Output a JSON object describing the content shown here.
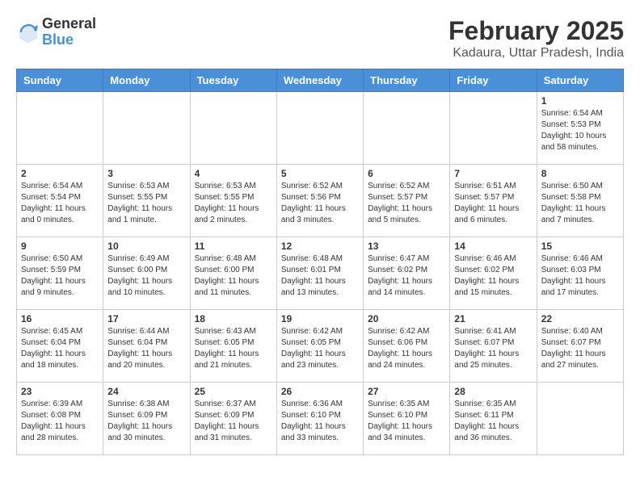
{
  "logo": {
    "general": "General",
    "blue": "Blue"
  },
  "header": {
    "month": "February 2025",
    "location": "Kadaura, Uttar Pradesh, India"
  },
  "weekdays": [
    "Sunday",
    "Monday",
    "Tuesday",
    "Wednesday",
    "Thursday",
    "Friday",
    "Saturday"
  ],
  "weeks": [
    [
      {
        "day": "",
        "info": ""
      },
      {
        "day": "",
        "info": ""
      },
      {
        "day": "",
        "info": ""
      },
      {
        "day": "",
        "info": ""
      },
      {
        "day": "",
        "info": ""
      },
      {
        "day": "",
        "info": ""
      },
      {
        "day": "1",
        "info": "Sunrise: 6:54 AM\nSunset: 5:53 PM\nDaylight: 10 hours\nand 58 minutes."
      }
    ],
    [
      {
        "day": "2",
        "info": "Sunrise: 6:54 AM\nSunset: 5:54 PM\nDaylight: 11 hours\nand 0 minutes."
      },
      {
        "day": "3",
        "info": "Sunrise: 6:53 AM\nSunset: 5:55 PM\nDaylight: 11 hours\nand 1 minute."
      },
      {
        "day": "4",
        "info": "Sunrise: 6:53 AM\nSunset: 5:55 PM\nDaylight: 11 hours\nand 2 minutes."
      },
      {
        "day": "5",
        "info": "Sunrise: 6:52 AM\nSunset: 5:56 PM\nDaylight: 11 hours\nand 3 minutes."
      },
      {
        "day": "6",
        "info": "Sunrise: 6:52 AM\nSunset: 5:57 PM\nDaylight: 11 hours\nand 5 minutes."
      },
      {
        "day": "7",
        "info": "Sunrise: 6:51 AM\nSunset: 5:57 PM\nDaylight: 11 hours\nand 6 minutes."
      },
      {
        "day": "8",
        "info": "Sunrise: 6:50 AM\nSunset: 5:58 PM\nDaylight: 11 hours\nand 7 minutes."
      }
    ],
    [
      {
        "day": "9",
        "info": "Sunrise: 6:50 AM\nSunset: 5:59 PM\nDaylight: 11 hours\nand 9 minutes."
      },
      {
        "day": "10",
        "info": "Sunrise: 6:49 AM\nSunset: 6:00 PM\nDaylight: 11 hours\nand 10 minutes."
      },
      {
        "day": "11",
        "info": "Sunrise: 6:48 AM\nSunset: 6:00 PM\nDaylight: 11 hours\nand 11 minutes."
      },
      {
        "day": "12",
        "info": "Sunrise: 6:48 AM\nSunset: 6:01 PM\nDaylight: 11 hours\nand 13 minutes."
      },
      {
        "day": "13",
        "info": "Sunrise: 6:47 AM\nSunset: 6:02 PM\nDaylight: 11 hours\nand 14 minutes."
      },
      {
        "day": "14",
        "info": "Sunrise: 6:46 AM\nSunset: 6:02 PM\nDaylight: 11 hours\nand 15 minutes."
      },
      {
        "day": "15",
        "info": "Sunrise: 6:46 AM\nSunset: 6:03 PM\nDaylight: 11 hours\nand 17 minutes."
      }
    ],
    [
      {
        "day": "16",
        "info": "Sunrise: 6:45 AM\nSunset: 6:04 PM\nDaylight: 11 hours\nand 18 minutes."
      },
      {
        "day": "17",
        "info": "Sunrise: 6:44 AM\nSunset: 6:04 PM\nDaylight: 11 hours\nand 20 minutes."
      },
      {
        "day": "18",
        "info": "Sunrise: 6:43 AM\nSunset: 6:05 PM\nDaylight: 11 hours\nand 21 minutes."
      },
      {
        "day": "19",
        "info": "Sunrise: 6:42 AM\nSunset: 6:05 PM\nDaylight: 11 hours\nand 23 minutes."
      },
      {
        "day": "20",
        "info": "Sunrise: 6:42 AM\nSunset: 6:06 PM\nDaylight: 11 hours\nand 24 minutes."
      },
      {
        "day": "21",
        "info": "Sunrise: 6:41 AM\nSunset: 6:07 PM\nDaylight: 11 hours\nand 25 minutes."
      },
      {
        "day": "22",
        "info": "Sunrise: 6:40 AM\nSunset: 6:07 PM\nDaylight: 11 hours\nand 27 minutes."
      }
    ],
    [
      {
        "day": "23",
        "info": "Sunrise: 6:39 AM\nSunset: 6:08 PM\nDaylight: 11 hours\nand 28 minutes."
      },
      {
        "day": "24",
        "info": "Sunrise: 6:38 AM\nSunset: 6:09 PM\nDaylight: 11 hours\nand 30 minutes."
      },
      {
        "day": "25",
        "info": "Sunrise: 6:37 AM\nSunset: 6:09 PM\nDaylight: 11 hours\nand 31 minutes."
      },
      {
        "day": "26",
        "info": "Sunrise: 6:36 AM\nSunset: 6:10 PM\nDaylight: 11 hours\nand 33 minutes."
      },
      {
        "day": "27",
        "info": "Sunrise: 6:35 AM\nSunset: 6:10 PM\nDaylight: 11 hours\nand 34 minutes."
      },
      {
        "day": "28",
        "info": "Sunrise: 6:35 AM\nSunset: 6:11 PM\nDaylight: 11 hours\nand 36 minutes."
      },
      {
        "day": "",
        "info": ""
      }
    ]
  ]
}
